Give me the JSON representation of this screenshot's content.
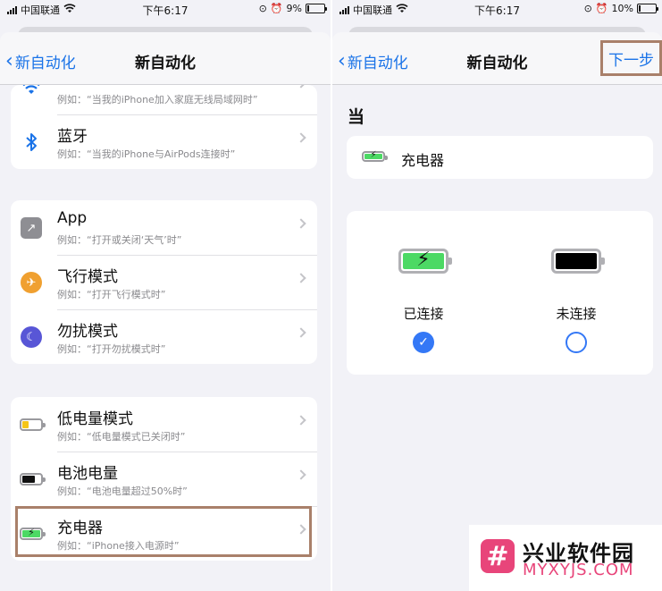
{
  "left": {
    "status": {
      "carrier": "中国联通",
      "time": "下午6:17",
      "battery_pct": "9%",
      "battery_level": 0.09
    },
    "nav": {
      "back": "新自动化",
      "title": "新自动化"
    },
    "group1": [
      {
        "title": "",
        "subtitle": "例如：“当我的iPhone加入家庭无线局域网时”",
        "icon": "wifi-icon"
      },
      {
        "title": "蓝牙",
        "subtitle": "例如：“当我的iPhone与AirPods连接时”",
        "icon": "bluetooth-icon"
      }
    ],
    "group2": [
      {
        "title": "App",
        "subtitle": "例如：“打开或关闭‘天气’时”",
        "icon": "app-arrow-icon",
        "color": "#8e8e93"
      },
      {
        "title": "飞行模式",
        "subtitle": "例如：“打开飞行模式时”",
        "icon": "airplane-icon",
        "color": "#f0a030"
      },
      {
        "title": "勿扰模式",
        "subtitle": "例如：“打开勿扰模式时”",
        "icon": "moon-icon",
        "color": "#5856d6"
      }
    ],
    "group3": [
      {
        "title": "低电量模式",
        "subtitle": "例如：“低电量模式已关闭时”",
        "icon": "low-battery-icon",
        "color": "#f5c518"
      },
      {
        "title": "电池电量",
        "subtitle": "例如：“电池电量超过50%时”",
        "icon": "battery-icon",
        "color": "#111111"
      },
      {
        "title": "充电器",
        "subtitle": "例如：“iPhone接入电源时”",
        "icon": "charging-battery-icon",
        "color": "#4cd964"
      }
    ]
  },
  "right": {
    "status": {
      "carrier": "中国联通",
      "time": "下午6:17",
      "battery_pct": "10%",
      "battery_level": 0.1
    },
    "nav": {
      "back": "新自动化",
      "title": "新自动化",
      "next": "下一步"
    },
    "section_label": "当",
    "trigger": {
      "label": "充电器",
      "icon": "charging-battery-icon"
    },
    "options": [
      {
        "label": "已连接",
        "selected": true,
        "icon": "charging-battery-icon",
        "color": "#4cd964"
      },
      {
        "label": "未连接",
        "selected": false,
        "icon": "battery-full-black-icon",
        "color": "#000000"
      }
    ]
  },
  "watermark": {
    "logo_char": "#",
    "title": "兴业软件园",
    "domain": "MYXYJS.COM"
  }
}
